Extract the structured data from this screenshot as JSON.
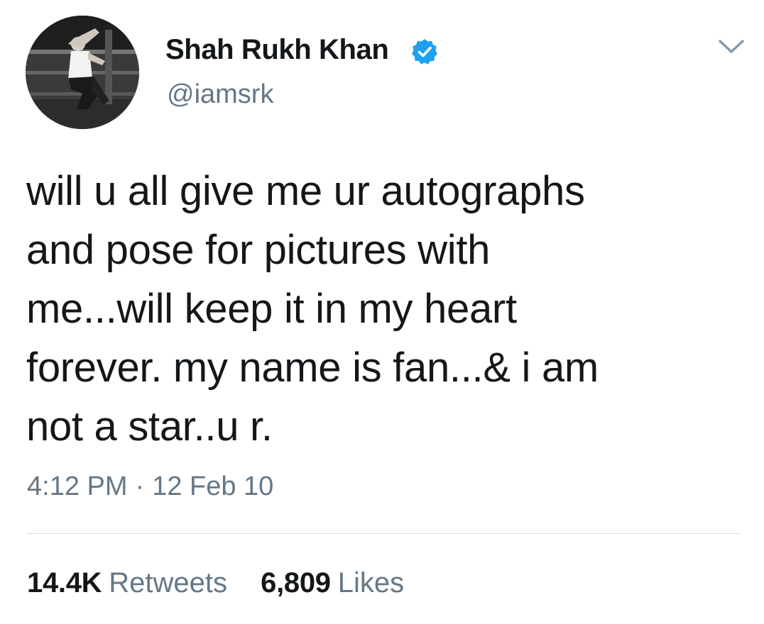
{
  "author": {
    "display_name": "Shah Rukh Khan",
    "handle": "@iamsrk",
    "verified": true,
    "verified_color": "#1da1f2",
    "avatar_icon": "profile-photo"
  },
  "menu": {
    "icon": "chevron-down-icon"
  },
  "tweet": {
    "text": "will u all give me ur autographs\nand pose for pictures with\nme...will keep it in my heart\nforever. my name is fan...& i am\nnot a star..u r.",
    "time": "4:12 PM",
    "separator": "·",
    "date": "12 Feb 10"
  },
  "stats": {
    "retweets_count": "14.4K",
    "retweets_label": "Retweets",
    "likes_count": "6,809",
    "likes_label": "Likes"
  },
  "colors": {
    "text": "#14171a",
    "secondary_text": "#657786",
    "divider": "#d6dde3",
    "accent": "#1da1f2"
  }
}
